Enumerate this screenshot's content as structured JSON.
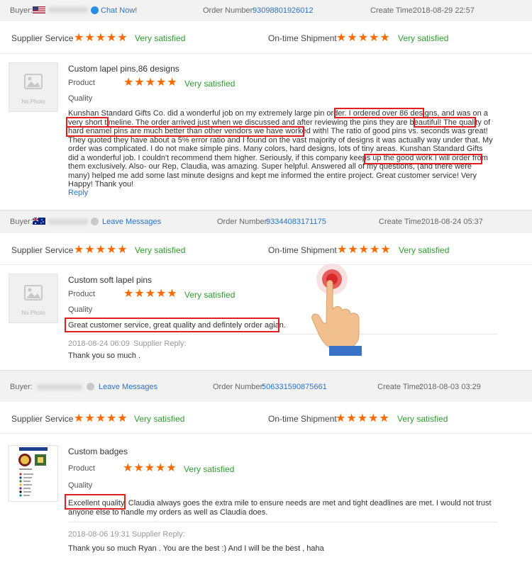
{
  "reviews": [
    {
      "buyer_label": "Buyer:",
      "contact_action": "Chat Now!",
      "order_label": "Order Number:",
      "order_number": "93098801926012",
      "create_label": "Create Time:",
      "create_time": "2018-08-29 22:57",
      "supplier_service_label": "Supplier Service",
      "supplier_service_rating": "Very satisfied",
      "shipment_label": "On-time Shipment",
      "shipment_rating": "Very satisfied",
      "product_title": "Custom lapel pins,86 designs",
      "product_label": "Product",
      "product_rating": "Very satisfied",
      "quality_label": "Quality",
      "review_text": "Kunshan Standard Gifts Co. did a wonderful job on my extremely large pin order. I ordered over 86 designs, and was on a very short timeline. The order arrived just when we discussed and after reviewing the pins they are beautiful! The quality of hard enamel pins are much better than other vendors we have worked with! The ratio of good pins vs. seconds was great! They quoted they have about a 5% error ratio and I found on the vast majority of designs it was actually way under that. My order was complicated. I do not make simple pins. Many colors, hard designs, lots of tiny areas. Kunshan Standard Gifts did a wonderful job. I couldn't recommend them higher. Seriously, if this company keeps up the good work I will order from them exclusively. Also- our Rep, Claudia, was amazing. Super helpful. Answered all of my questions, (and there were many) helped me add some last minute designs and kept me informed the entire project. Great customer service! Very Happy! Thank you!",
      "reply_link": "Reply"
    },
    {
      "buyer_label": "Buyer:",
      "contact_action": "Leave Messages",
      "order_label": "Order Number:",
      "order_number": "93344083171175",
      "create_label": "Create Time:",
      "create_time": "2018-08-24 05:37",
      "supplier_service_label": "Supplier Service",
      "supplier_service_rating": "Very satisfied",
      "shipment_label": "On-time Shipment",
      "shipment_rating": "Very satisfied",
      "product_title": "Custom soft lapel pins",
      "product_label": "Product",
      "product_rating": "Very satisfied",
      "quality_label": "Quality",
      "review_text": "Great customer service, great quality and defintely order agian.",
      "reply_date": "2018-08-24 06:09",
      "reply_label": "Supplier Reply:",
      "reply_text": "Thank you so much ."
    },
    {
      "buyer_label": "Buyer:",
      "contact_action": "Leave Messages",
      "order_label": "Order Number:",
      "order_number": "506331590875661",
      "create_label": "Create Time:",
      "create_time": "2018-08-03 03:29",
      "supplier_service_label": "Supplier Service",
      "supplier_service_rating": "Very satisfied",
      "shipment_label": "On-time Shipment",
      "shipment_rating": "Very satisfied",
      "product_title": "Custom badges",
      "product_label": "Product",
      "product_rating": "Very satisfied",
      "quality_label": "Quality",
      "review_text_highlight": "Excellent quality.",
      "review_text": " Claudia always goes the extra mile to ensure needs are met and tight deadlines are met. I would not trust anyone else to handle my orders as well as Claudia does.",
      "reply_date": "2018-08-06 19:31",
      "reply_label": "Supplier Reply:",
      "reply_text": "Thank you so much Ryan . You are the best :) And I will be the best , haha"
    }
  ],
  "placeholder": {
    "no_photo": "No Photo"
  },
  "icons": {
    "star": "★",
    "photo_placeholder": "image-icon",
    "chat": "chat-icon",
    "message": "message-icon",
    "hand": "pointing-hand-icon"
  },
  "colors": {
    "star": "#ff6a00",
    "satisfied": "#2e9e2e",
    "link": "#2a73c9",
    "highlight_box": "#e02020"
  }
}
